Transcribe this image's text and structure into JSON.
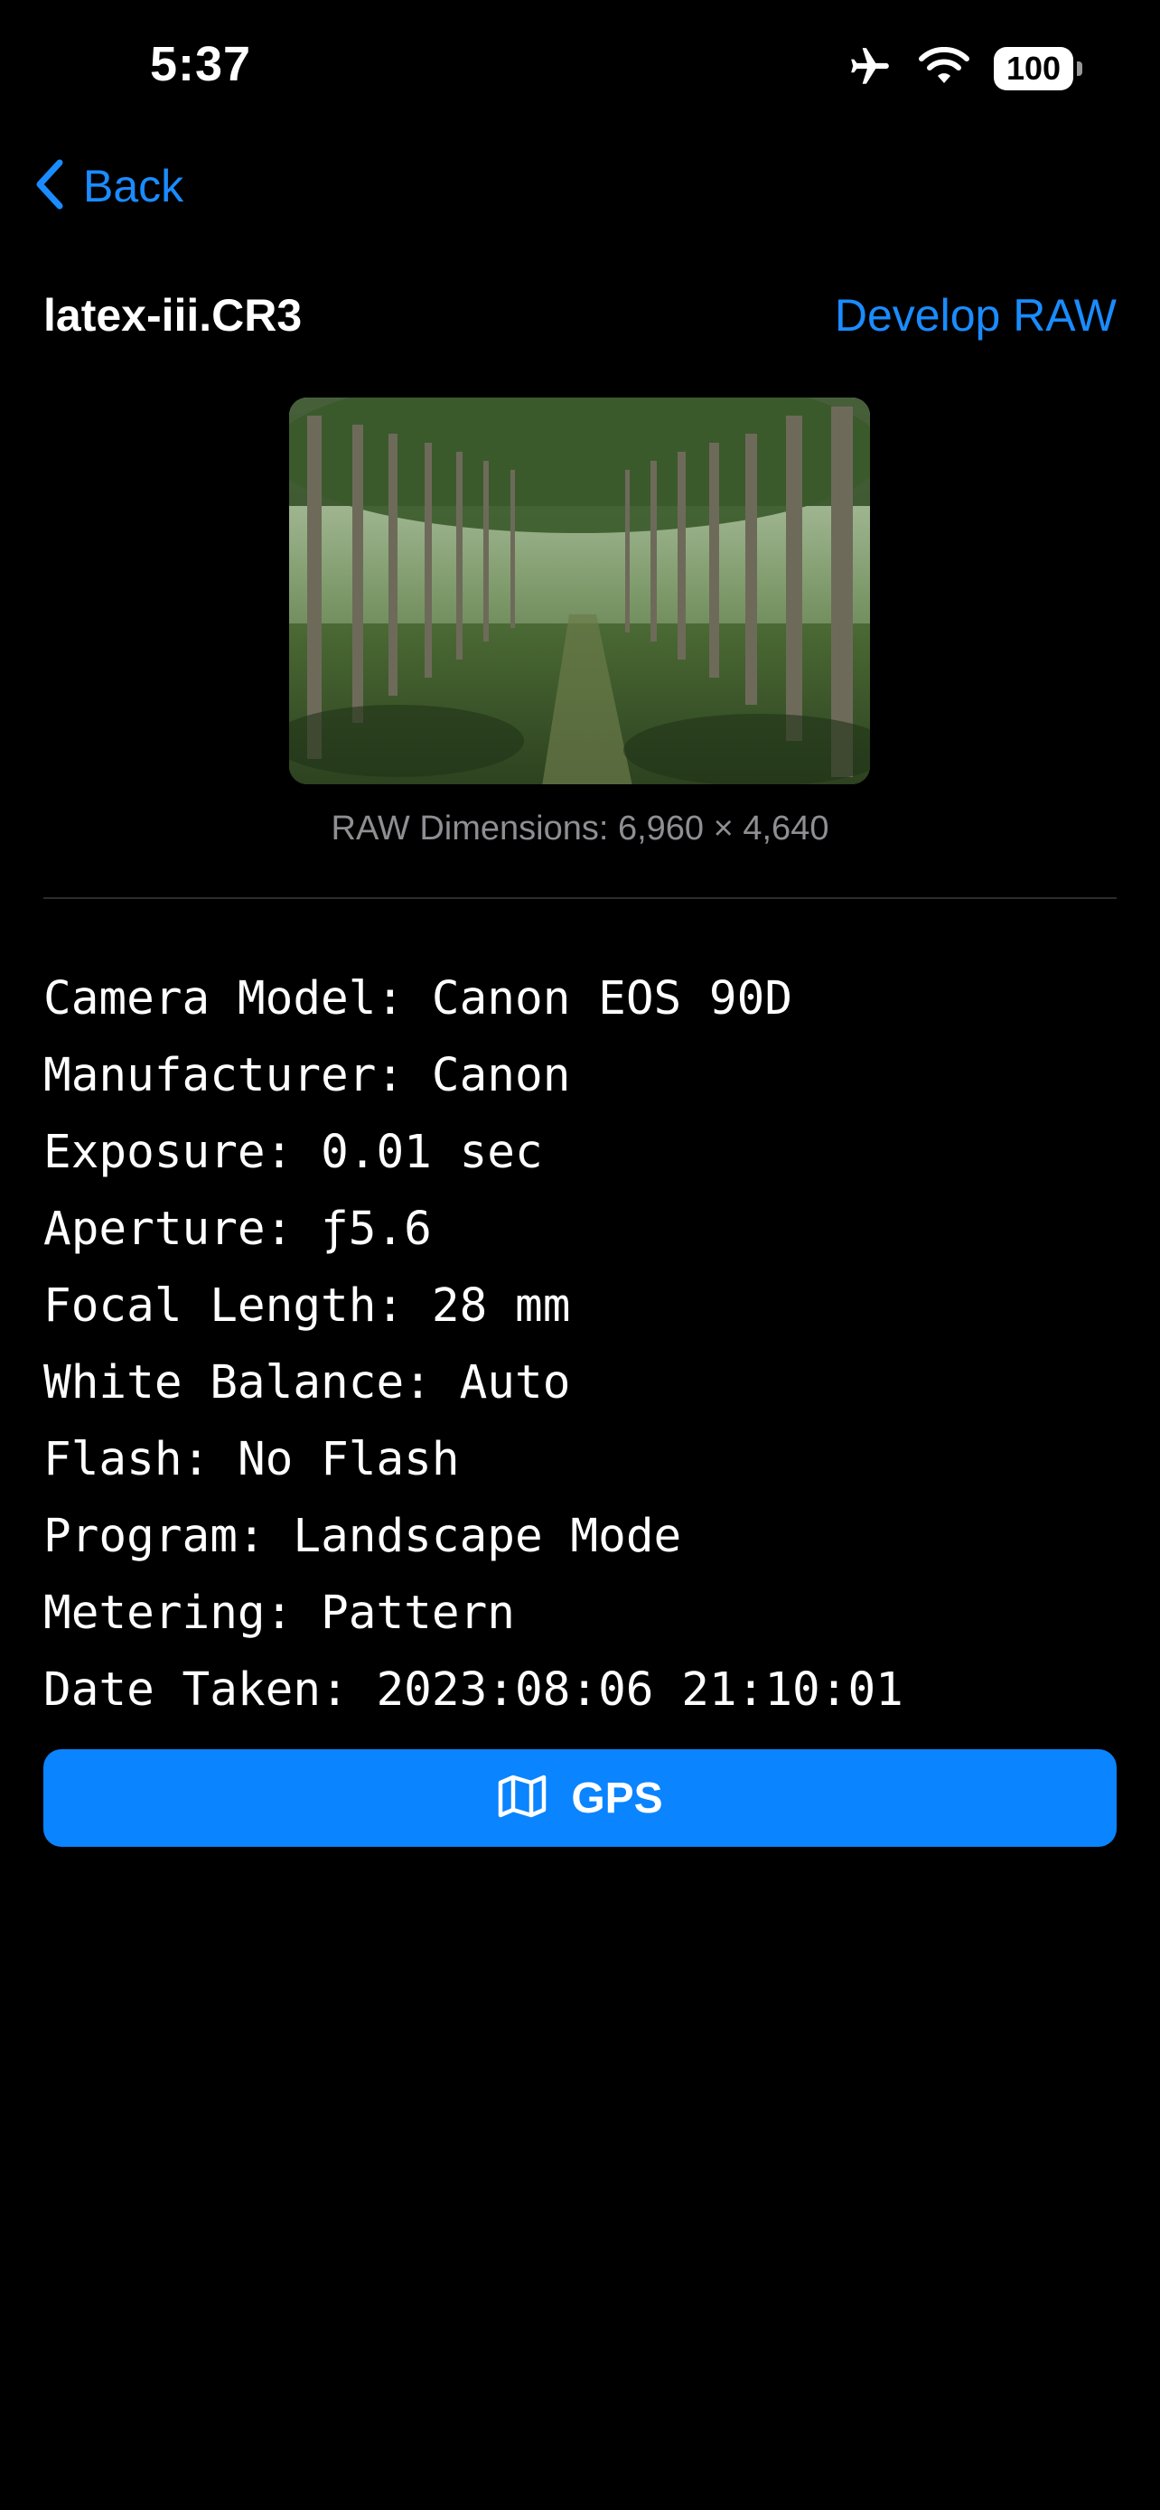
{
  "status_bar": {
    "time": "5:37",
    "battery": "100",
    "icons": [
      "airplane-icon",
      "wifi-icon",
      "battery-icon"
    ]
  },
  "nav": {
    "back_label": "Back"
  },
  "header": {
    "file_name": "latex-iii.CR3",
    "develop_label": "Develop RAW"
  },
  "image": {
    "dimensions_text": "RAW Dimensions: 6,960 × 4,640"
  },
  "metadata": [
    {
      "label": "Camera Model",
      "value": "Canon EOS 90D"
    },
    {
      "label": "Manufacturer",
      "value": "Canon"
    },
    {
      "label": "Exposure",
      "value": "0.01 sec"
    },
    {
      "label": "Aperture",
      "value": "ƒ5.6"
    },
    {
      "label": "Focal Length",
      "value": "28 mm"
    },
    {
      "label": "White Balance",
      "value": "Auto"
    },
    {
      "label": "Flash",
      "value": "No Flash"
    },
    {
      "label": "Program",
      "value": "Landscape Mode"
    },
    {
      "label": "Metering",
      "value": "Pattern"
    },
    {
      "label": "Date Taken",
      "value": "2023:08:06 21:10:01"
    }
  ],
  "gps_button": {
    "label": "GPS",
    "icon": "map-icon"
  },
  "colors": {
    "accent": "#1a8cff",
    "button": "#0a84ff",
    "background": "#000000",
    "secondary_text": "#8e8e93"
  }
}
